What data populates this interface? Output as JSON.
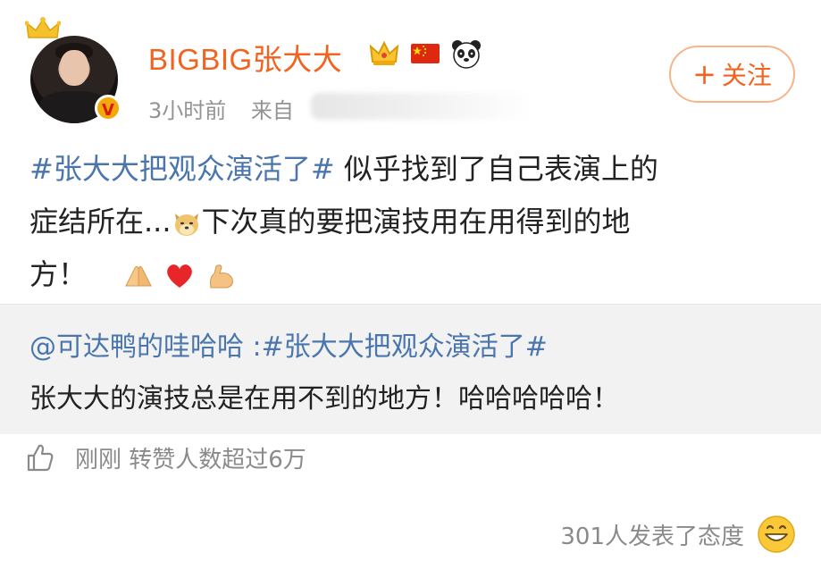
{
  "post": {
    "username": "BIGBIG张大大",
    "time": "3小时前",
    "source_prefix": "来自",
    "follow_label": "关注",
    "follow_plus": "+",
    "topic": "#张大大把观众演活了#",
    "text1": " 似乎找到了自己表演上的",
    "text2": "症结所在...",
    "text3": "下次真的要把演技用在用得到的地",
    "text4": "方！",
    "badges": [
      "crown-badge-icon",
      "china-flag-icon",
      "panda-icon"
    ],
    "emojis": [
      "doge-icon",
      "praying-hands-icon",
      "red-heart-icon",
      "flexed-biceps-icon"
    ]
  },
  "repost": {
    "author": "@可达鸭的哇哈哈",
    "topic": " :#张大大把观众演活了#",
    "text": "张大大的演技总是在用不到的地方！哈哈哈哈哈！"
  },
  "like_row": {
    "text": "刚刚 转赞人数超过6万"
  },
  "reaction": {
    "text": "301人发表了态度"
  },
  "colors": {
    "username": "#f2631f",
    "topic": "#4a76ad",
    "meta": "#939393",
    "repost_bg": "#f2f2f2"
  }
}
